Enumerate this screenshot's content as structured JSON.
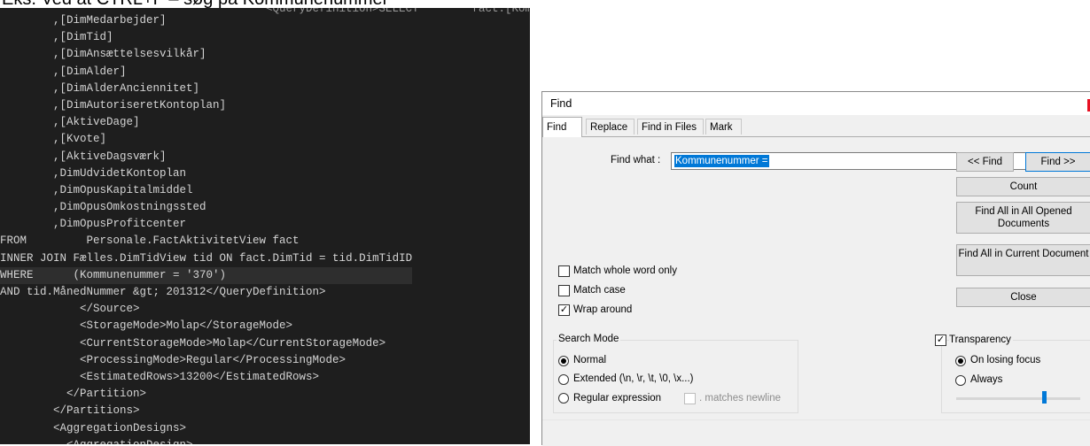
{
  "caption": "Eks. Ved at CTRL+F – søg på Kommunenummer",
  "editor": {
    "ghost_top_text": "<QueryDefinition>SELECT        fact.[Kommunenummer]",
    "lines": [
      "        ,[DimMedarbejder]",
      "        ,[DimTid]",
      "        ,[DimAnsættelsesvilkår]",
      "        ,[DimAlder]",
      "        ,[DimAlderAnciennitet]",
      "        ,[DimAutoriseretKontoplan]",
      "        ,[AktiveDage]",
      "        ,[Kvote]",
      "        ,[AktiveDagsværk]",
      "        ,DimUdvidetKontoplan",
      "        ,DimOpusKapitalmiddel",
      "        ,DimOpusOmkostningssted",
      "        ,DimOpusProfitcenter",
      "FROM         Personale.FactAktivitetView fact",
      "INNER JOIN Fælles.DimTidView tid ON fact.DimTid = tid.DimTidID",
      "WHERE      (Kommunenummer = '370')",
      "AND tid.MånedNummer &gt; 201312</QueryDefinition>",
      "            </Source>",
      "            <StorageMode>Molap</StorageMode>",
      "            <CurrentStorageMode>Molap</CurrentStorageMode>",
      "            <ProcessingMode>Regular</ProcessingMode>",
      "            <EstimatedRows>13200</EstimatedRows>",
      "          </Partition>",
      "        </Partitions>",
      "        <AggregationDesigns>",
      "          <AggregationDesign>"
    ]
  },
  "dialog": {
    "title": "Find",
    "tabs": [
      "Find",
      "Replace",
      "Find in Files",
      "Mark"
    ],
    "find_what_label": "Find what :",
    "find_what_value": "Kommunenummer =",
    "buttons": {
      "find_prev": "<< Find",
      "find_next": "Find >>",
      "count": "Count",
      "find_all_opened": "Find All in All Opened Documents",
      "find_all_current": "Find All in Current Document",
      "close": "Close"
    },
    "options": {
      "match_whole_word": "Match whole word only",
      "match_case": "Match case",
      "wrap_around": "Wrap around"
    },
    "search_mode": {
      "title": "Search Mode",
      "normal": "Normal",
      "extended": "Extended (\\n, \\r, \\t, \\0, \\x...)",
      "regex": "Regular expression",
      "matches_newline": ". matches newline"
    },
    "transparency": {
      "title": "Transparency",
      "on_losing_focus": "On losing focus",
      "always": "Always",
      "level": 0.72
    },
    "accent_color": "#0078d7",
    "close_color": "#e81123"
  }
}
